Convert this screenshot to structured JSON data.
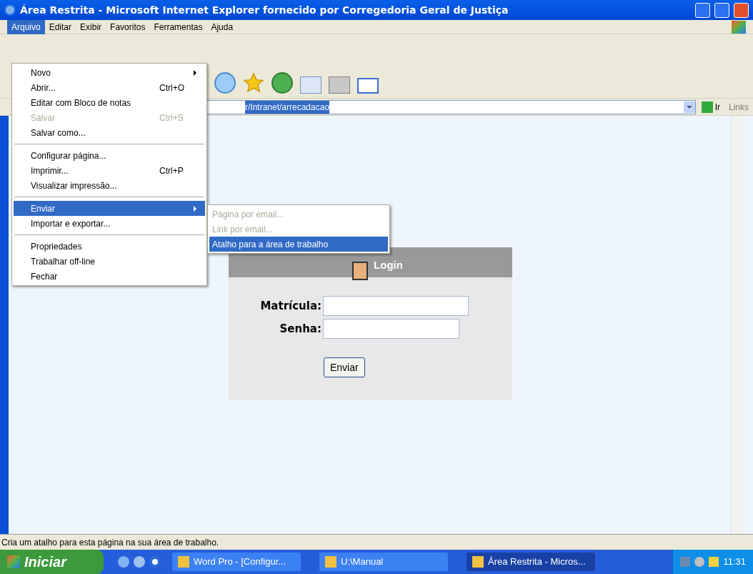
{
  "window": {
    "title": "Área Restrita - Microsoft Internet Explorer fornecido por Corregedoria Geral de Justiça"
  },
  "menubar": [
    {
      "label": "Arquivo",
      "selected": true
    },
    {
      "label": "Editar",
      "selected": false
    },
    {
      "label": "Exibir",
      "selected": false
    },
    {
      "label": "Favoritos",
      "selected": false
    },
    {
      "label": "Ferramentas",
      "selected": false
    },
    {
      "label": "Ajuda",
      "selected": false
    }
  ],
  "file_menu": [
    {
      "kind": "item",
      "label": "Novo",
      "submenu": true,
      "disabled": false,
      "selected": false
    },
    {
      "kind": "item",
      "label": "Abrir...",
      "shortcut": "Ctrl+O",
      "disabled": false,
      "selected": false
    },
    {
      "kind": "item",
      "label": "Editar com Bloco de notas",
      "disabled": false,
      "selected": false
    },
    {
      "kind": "item",
      "label": "Salvar",
      "shortcut": "Ctrl+S",
      "disabled": true,
      "selected": false
    },
    {
      "kind": "item",
      "label": "Salvar como...",
      "disabled": false,
      "selected": false
    },
    {
      "kind": "separator"
    },
    {
      "kind": "item",
      "label": "Configurar página...",
      "disabled": false,
      "selected": false
    },
    {
      "kind": "item",
      "label": "Imprimir...",
      "shortcut": "Ctrl+P",
      "disabled": false,
      "selected": false
    },
    {
      "kind": "item",
      "label": "Visualizar impressão...",
      "disabled": false,
      "selected": false
    },
    {
      "kind": "separator"
    },
    {
      "kind": "item",
      "label": "Enviar",
      "submenu": true,
      "disabled": false,
      "selected": true
    },
    {
      "kind": "item",
      "label": "Importar e exportar...",
      "disabled": false,
      "selected": false
    },
    {
      "kind": "separator"
    },
    {
      "kind": "item",
      "label": "Propriedades",
      "disabled": false,
      "selected": false
    },
    {
      "kind": "item",
      "label": "Trabalhar off-line",
      "disabled": false,
      "selected": false
    },
    {
      "kind": "item",
      "label": "Fechar",
      "disabled": false,
      "selected": false
    }
  ],
  "send_submenu": [
    {
      "label": "Página por email...",
      "disabled": true,
      "selected": false
    },
    {
      "label": "Link por email...",
      "disabled": true,
      "selected": false
    },
    {
      "label": "Atalho para a área de trabalho",
      "disabled": false,
      "selected": true
    }
  ],
  "address_bar": {
    "value": "r/Intranet/arrecadacao",
    "go": "Ir",
    "links": "Links"
  },
  "login": {
    "title": "Login",
    "fields": [
      {
        "label": "Matrícula:"
      },
      {
        "label": "Senha:"
      }
    ],
    "submit": "Enviar"
  },
  "status_bar": "Cria um atalho para esta página na sua área de trabalho.",
  "taskbar": {
    "start": "Iniciar",
    "tasks": [
      {
        "label": "Word Pro - [Configur...",
        "selected": false
      },
      {
        "label": "U:\\Manual",
        "selected": false
      },
      {
        "label": "Área Restrita - Micros...",
        "selected": true
      }
    ],
    "clock": "11:31"
  }
}
